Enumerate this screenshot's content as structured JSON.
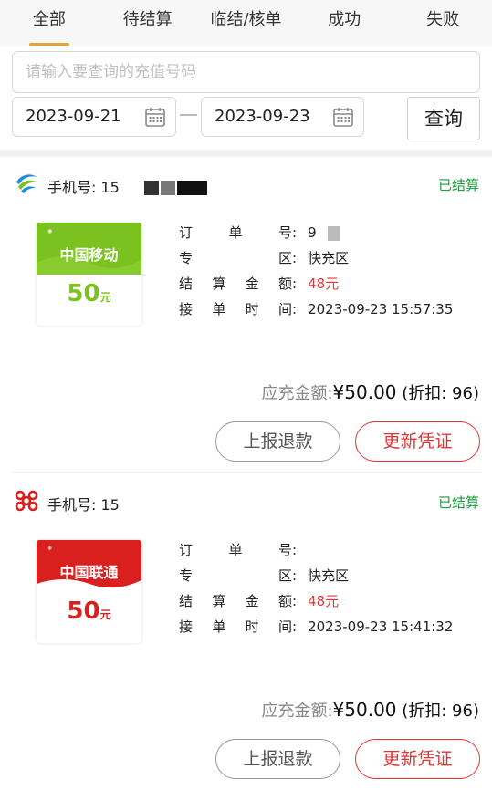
{
  "tabs": [
    {
      "label": "全部",
      "active": true
    },
    {
      "label": "待结算",
      "active": false
    },
    {
      "label": "临结/核单",
      "active": false
    },
    {
      "label": "成功",
      "active": false
    },
    {
      "label": "失败",
      "active": false
    }
  ],
  "search": {
    "placeholder": "请输入要查询的充值号码",
    "value": ""
  },
  "date_range": {
    "start": "2023-09-21",
    "end": "2023-09-23"
  },
  "query_button": "查询",
  "colors": {
    "accent": "#e6a23c",
    "success": "#1a9b3e",
    "danger": "#e03434",
    "mobile_green": "#7bc11f",
    "unicom_red": "#d9201e"
  },
  "orders": [
    {
      "operator_icon": "china-mobile-icon",
      "phone_label": "手机号:",
      "phone_visible": "15",
      "status": "已结算",
      "card_brand": "中国移动",
      "card_amount": "50",
      "card_unit": "元",
      "order_no_label": "订单号",
      "order_no": "9",
      "zone_label": "专区",
      "zone": "快充区",
      "settle_label": "结算金额",
      "settle_amount": "48元",
      "time_label": "接单时间",
      "time": "2023-09-23 15:57:35",
      "total_label": "应充金额:",
      "total_amount": "¥50.00",
      "discount": "(折扣: 96)",
      "refund_button": "上报退款",
      "update_button": "更新凭证"
    },
    {
      "operator_icon": "china-unicom-icon",
      "phone_label": "手机号:",
      "phone_visible": "15",
      "status": "已结算",
      "card_brand": "中国联通",
      "card_amount": "50",
      "card_unit": "元",
      "order_no_label": "订单号",
      "order_no": "",
      "zone_label": "专区",
      "zone": "快充区",
      "settle_label": "结算金额",
      "settle_amount": "48元",
      "time_label": "接单时间",
      "time": "2023-09-23 15:41:32",
      "total_label": "应充金额:",
      "total_amount": "¥50.00",
      "discount": "(折扣: 96)",
      "refund_button": "上报退款",
      "update_button": "更新凭证"
    }
  ]
}
